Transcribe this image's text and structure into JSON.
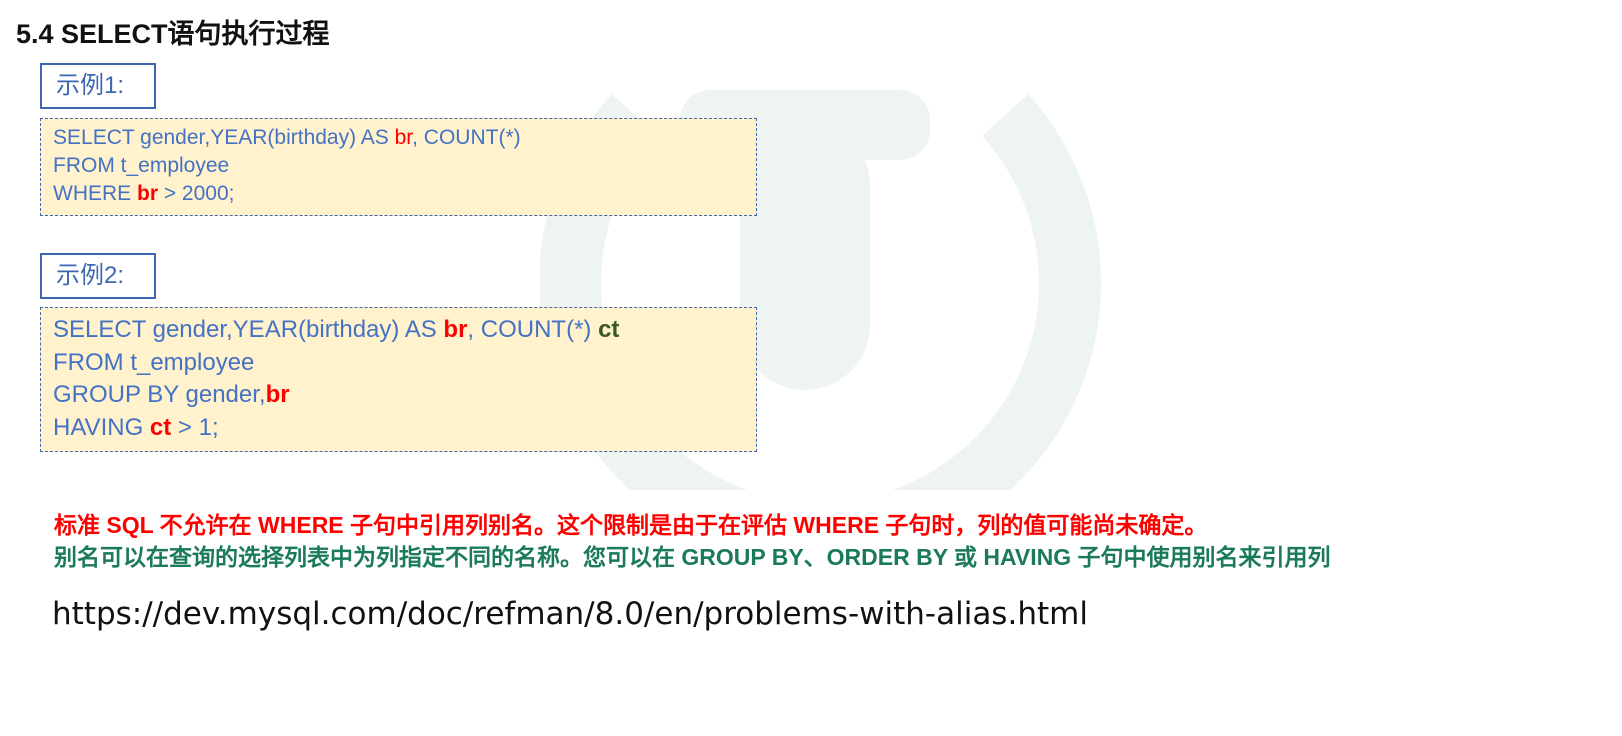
{
  "title": "5.4 SELECT语句执行过程",
  "example1": {
    "label": "示例1:",
    "lines": [
      {
        "a": "SELECT gender,YEAR(birthday) AS ",
        "b": "br",
        "c": ", COUNT(*)"
      },
      {
        "a": "FROM t_employee"
      },
      {
        "a": "WHERE ",
        "b": "br",
        "c": " > 2000;"
      }
    ]
  },
  "example2": {
    "label": "示例2:",
    "lines": [
      {
        "a": "SELECT gender,YEAR(birthday) AS ",
        "b": "br",
        "c": ", COUNT(*) ",
        "d": "ct"
      },
      {
        "a": "FROM t_employee"
      },
      {
        "a": "GROUP BY gender,",
        "b": "br"
      },
      {
        "a": "HAVING ",
        "b": "ct",
        "c": " > 1;"
      }
    ]
  },
  "notes": {
    "red": "标准 SQL 不允许在 WHERE 子句中引用列别名。这个限制是由于在评估 WHERE 子句时，列的值可能尚未确定。",
    "green": "别名可以在查询的选择列表中为列指定不同的名称。您可以在 GROUP BY、ORDER BY 或 HAVING 子句中使用别名来引用列"
  },
  "url": "https://dev.mysql.com/doc/refman/8.0/en/problems-with-alias.html",
  "colors": {
    "code_text": "#4472c4",
    "code_bg": "#fff2cc",
    "highlight_red": "#ff0000",
    "highlight_green": "#385723",
    "note_green": "#1a7a5a"
  }
}
